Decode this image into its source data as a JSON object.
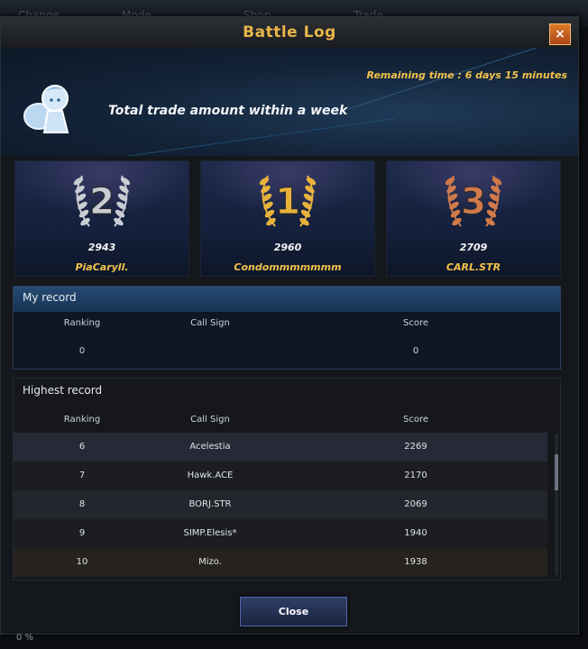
{
  "background": {
    "tabs": [
      "Change",
      "Mode",
      "Shop",
      "Trade"
    ]
  },
  "window": {
    "title": "Battle Log",
    "close_icon": "×"
  },
  "header": {
    "remaining": "Remaining time : 6 days 15 minutes",
    "subtitle": "Total trade amount within a week"
  },
  "podium": [
    {
      "rank": "2",
      "score": "2943",
      "name": "PiaCaryll.",
      "color": "#c9ccd2"
    },
    {
      "rank": "1",
      "score": "2960",
      "name": "Condommmmmmm",
      "color": "#e8b33c"
    },
    {
      "rank": "3",
      "score": "2709",
      "name": "CARL.STR",
      "color": "#d07a4a"
    }
  ],
  "my_record": {
    "title": "My record",
    "headers": {
      "ranking": "Ranking",
      "call_sign": "Call Sign",
      "score": "Score"
    },
    "row": {
      "ranking": "0",
      "call_sign": "",
      "score": "0"
    }
  },
  "highest_record": {
    "title": "Highest record",
    "headers": {
      "ranking": "Ranking",
      "call_sign": "Call Sign",
      "score": "Score"
    },
    "rows": [
      {
        "ranking": "6",
        "call_sign": "Acelestia",
        "score": "2269"
      },
      {
        "ranking": "7",
        "call_sign": "Hawk.ACE",
        "score": "2170"
      },
      {
        "ranking": "8",
        "call_sign": "BORJ.STR",
        "score": "2069"
      },
      {
        "ranking": "9",
        "call_sign": "SIMP.Elesis*",
        "score": "1940"
      },
      {
        "ranking": "10",
        "call_sign": "Mizo.",
        "score": "1938"
      }
    ]
  },
  "buttons": {
    "close": "Close"
  },
  "footer": {
    "percent": "0 %"
  }
}
